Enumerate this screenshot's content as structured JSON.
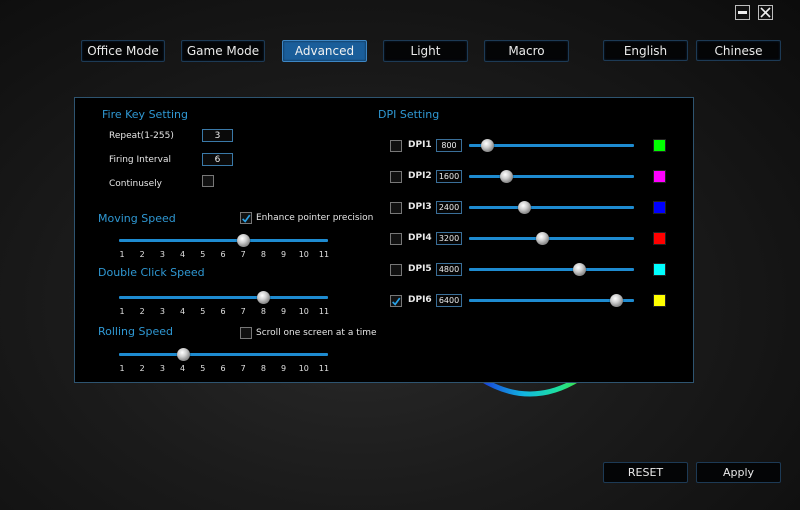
{
  "window": {
    "minimize_icon": "minimize-icon",
    "close_icon": "close-icon"
  },
  "tabs": [
    {
      "label": "Office Mode",
      "active": false
    },
    {
      "label": "Game Mode",
      "active": false
    },
    {
      "label": "Advanced",
      "active": true
    },
    {
      "label": "Light",
      "active": false
    },
    {
      "label": "Macro",
      "active": false
    }
  ],
  "language": {
    "english": "English",
    "chinese": "Chinese"
  },
  "fire_key": {
    "title": "Fire Key Setting",
    "repeat_label": "Repeat(1-255)",
    "repeat_value": "3",
    "interval_label": "Firing Interval",
    "interval_value": "6",
    "continuous_label": "Continusely",
    "continuous_checked": false
  },
  "moving_speed": {
    "title": "Moving Speed",
    "enhance_label": "Enhance pointer precision",
    "enhance_checked": true,
    "value": 7,
    "ticks": [
      "1",
      "2",
      "3",
      "4",
      "5",
      "6",
      "7",
      "8",
      "9",
      "10",
      "11"
    ]
  },
  "double_click": {
    "title": "Double Click Speed",
    "value": 8,
    "ticks": [
      "1",
      "2",
      "3",
      "4",
      "5",
      "6",
      "7",
      "8",
      "9",
      "10",
      "11"
    ]
  },
  "rolling": {
    "title": "Rolling Speed",
    "scroll_label": "Scroll one screen at a time",
    "scroll_checked": false,
    "value": 4,
    "ticks": [
      "1",
      "2",
      "3",
      "4",
      "5",
      "6",
      "7",
      "8",
      "9",
      "10",
      "11"
    ]
  },
  "dpi": {
    "title": "DPI Setting",
    "max": 7200,
    "rows": [
      {
        "label": "DPI1",
        "value": "800",
        "checked": false,
        "color": "#00ff00"
      },
      {
        "label": "DPI2",
        "value": "1600",
        "checked": false,
        "color": "#ff00ff"
      },
      {
        "label": "DPI3",
        "value": "2400",
        "checked": false,
        "color": "#0000ff"
      },
      {
        "label": "DPI4",
        "value": "3200",
        "checked": false,
        "color": "#ff0000"
      },
      {
        "label": "DPI5",
        "value": "4800",
        "checked": false,
        "color": "#00ffff"
      },
      {
        "label": "DPI6",
        "value": "6400",
        "checked": true,
        "color": "#ffff00"
      }
    ]
  },
  "footer": {
    "reset": "RESET",
    "apply": "Apply"
  }
}
